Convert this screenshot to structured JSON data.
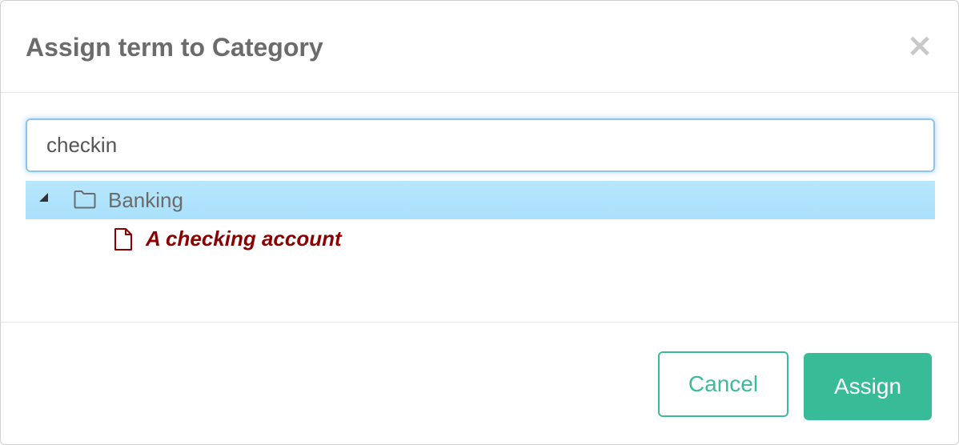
{
  "dialog": {
    "title": "Assign term to Category",
    "close_glyph": "×"
  },
  "search": {
    "value": "checkin",
    "placeholder": ""
  },
  "tree": {
    "root": {
      "label": "Banking",
      "icon": "folder-icon",
      "expanded": true,
      "selected": true
    },
    "children": [
      {
        "label": "A checking account",
        "icon": "file-icon"
      }
    ]
  },
  "footer": {
    "cancel_label": "Cancel",
    "assign_label": "Assign"
  },
  "colors": {
    "accent": "#38bb97",
    "selection": "#b3e5fc",
    "match_text": "#8b0000",
    "focus_border": "#8ec4ea"
  }
}
